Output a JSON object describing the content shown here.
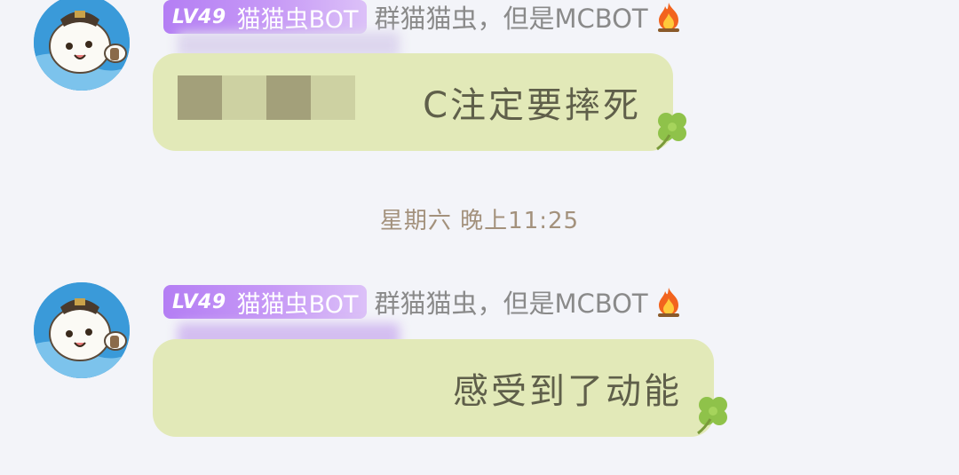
{
  "messages": [
    {
      "sender": {
        "level": "LV49",
        "title": "猫猫虫BOT",
        "group_nickname": "群猫猫虫，但是MCBOT"
      },
      "text": "C注定要摔死",
      "redacted_prefix": true
    },
    {
      "sender": {
        "level": "LV49",
        "title": "猫猫虫BOT",
        "group_nickname": "群猫猫虫，但是MCBOT"
      },
      "text": "感受到了动能",
      "redacted_prefix": false
    }
  ],
  "timestamp": "星期六 晚上11:25",
  "icons": {
    "fire": "fire-emoji-icon",
    "clover": "four-leaf-clover-icon",
    "avatar": "cat-bug-avatar"
  },
  "colors": {
    "background": "#f3f4f9",
    "bubble": "#e2e9b8",
    "badge_start": "#b47ef4",
    "badge_end": "#dcc1f8",
    "timestamp": "#a3917c",
    "nickname": "#8a8a8a"
  }
}
